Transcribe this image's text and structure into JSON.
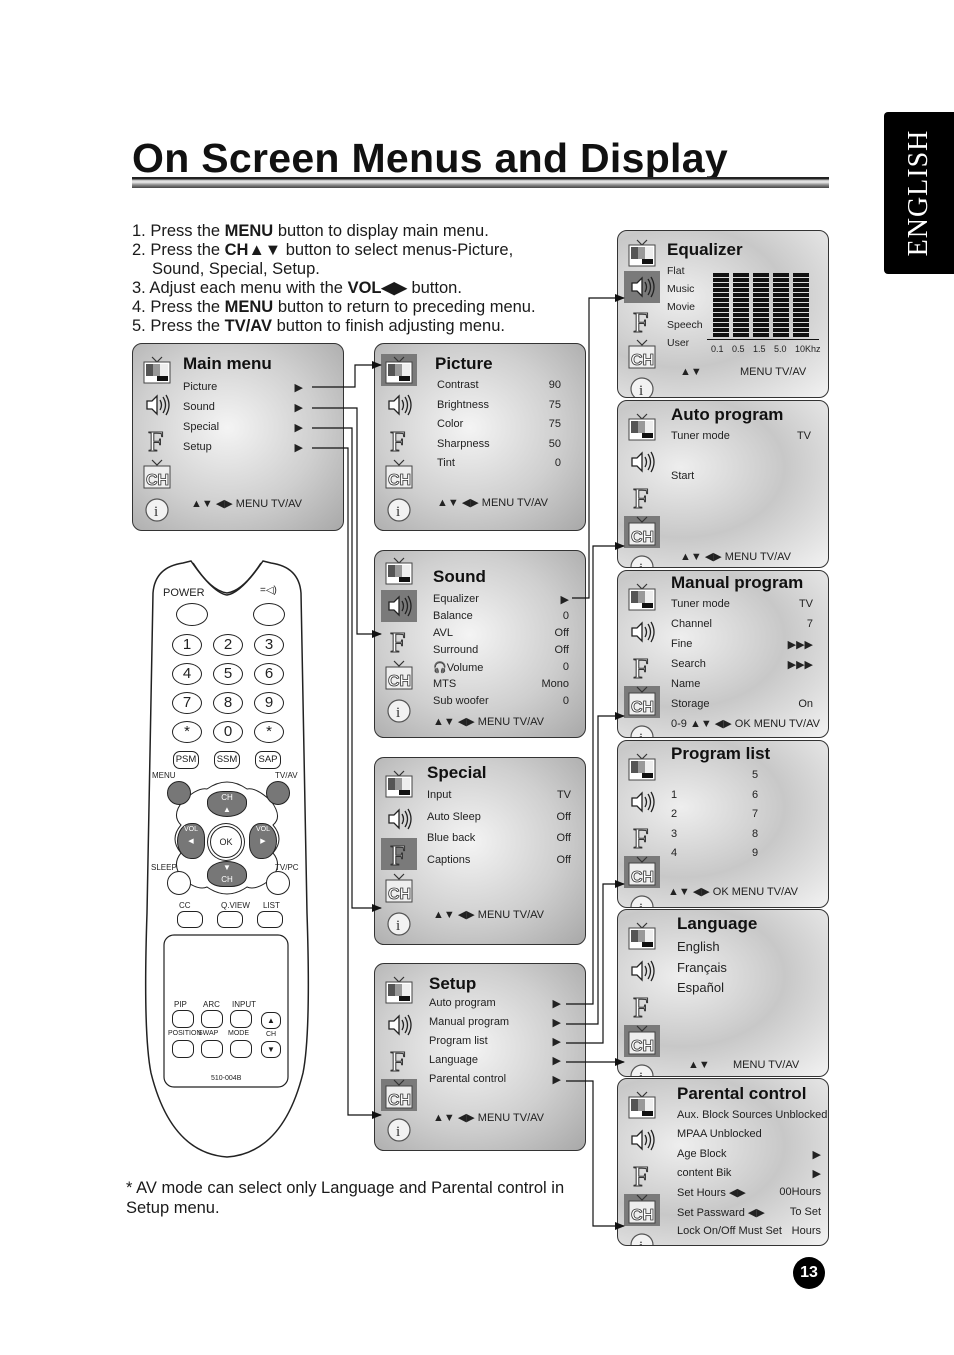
{
  "page": {
    "title": "On Screen Menus and Display",
    "language_tab": "ENGLISH",
    "page_number": "13",
    "footnote": "* AV mode can select only Language and Parental control in Setup menu."
  },
  "steps": [
    {
      "pre": "1. Press the ",
      "bold": "MENU",
      "post": " button to display main menu."
    },
    {
      "pre": "2. Press the ",
      "bold": "CH▲▼",
      "post": " button to select menus-Picture,"
    },
    {
      "pre": "",
      "bold": "",
      "post": "Sound, Special, Setup."
    },
    {
      "pre": "3. Adjust each menu with the ",
      "bold": "VOL◀▶",
      "post": " button."
    },
    {
      "pre": "4. Press the ",
      "bold": "MENU",
      "post": " button to return to preceding menu."
    },
    {
      "pre": "5. Press the ",
      "bold": "TV/AV",
      "post": " button to finish adjusting menu."
    }
  ],
  "icons": [
    "picture-icon",
    "sound-icon",
    "special-icon",
    "setup-ch-icon",
    "info-icon"
  ],
  "menus": {
    "main": {
      "title": "Main menu",
      "rows": [
        {
          "label": "Picture",
          "value": "▶"
        },
        {
          "label": "Sound",
          "value": "▶"
        },
        {
          "label": "Special",
          "value": "▶"
        },
        {
          "label": "Setup",
          "value": "▶"
        }
      ],
      "footer": "▲▼ ◀▶ MENU TV/AV"
    },
    "picture": {
      "title": "Picture",
      "rows": [
        {
          "label": "Contrast",
          "value": "90"
        },
        {
          "label": "Brightness",
          "value": "75"
        },
        {
          "label": "Color",
          "value": "75"
        },
        {
          "label": "Sharpness",
          "value": "50"
        },
        {
          "label": "Tint",
          "value": "0"
        }
      ],
      "footer": "▲▼ ◀▶    MENU    TV/AV"
    },
    "sound": {
      "title": "Sound",
      "rows": [
        {
          "label": "Equalizer",
          "value": "▶"
        },
        {
          "label": "Balance",
          "value": "0"
        },
        {
          "label": "AVL",
          "value": "Off"
        },
        {
          "label": "Surround",
          "value": "Off"
        },
        {
          "label": "🎧Volume",
          "value": "0"
        },
        {
          "label": "MTS",
          "value": "Mono"
        },
        {
          "label": "Sub woofer",
          "value": "0"
        }
      ],
      "footer": "▲▼ ◀▶   MENU  TV/AV"
    },
    "special": {
      "title": "Special",
      "rows": [
        {
          "label": "Input",
          "value": "TV"
        },
        {
          "label": "Auto Sleep",
          "value": "Off"
        },
        {
          "label": "Blue back",
          "value": "Off"
        },
        {
          "label": "Captions",
          "value": "Off"
        }
      ],
      "footer": "▲▼ ◀▶   MENU   TV/AV"
    },
    "setup": {
      "title": "Setup",
      "rows": [
        {
          "label": "Auto program",
          "value": "▶"
        },
        {
          "label": "Manual program",
          "value": "▶"
        },
        {
          "label": "Program list",
          "value": "▶"
        },
        {
          "label": "Language",
          "value": "▶"
        },
        {
          "label": "Parental control",
          "value": "▶"
        }
      ],
      "footer": "▲▼ ◀▶ MENU TV/AV"
    },
    "equalizer": {
      "title": "Equalizer",
      "modes": [
        "Flat",
        "Music",
        "Movie",
        "Speech",
        "User"
      ],
      "bands": [
        "0.1",
        "0.5",
        "1.5",
        "5.0",
        "10Khz"
      ],
      "levels": [
        0.5,
        0.5,
        0.5,
        0.5,
        0.5
      ],
      "footer_left": "▲▼",
      "footer_right": "MENU  TV/AV"
    },
    "auto_program": {
      "title": "Auto program",
      "rows": [
        {
          "label": "Tuner mode",
          "value": "TV"
        },
        {
          "label": "Start",
          "value": ""
        }
      ],
      "footer": "▲▼ ◀▶    MENU    TV/AV"
    },
    "manual_program": {
      "title": "Manual program",
      "rows": [
        {
          "label": "Tuner mode",
          "value": "TV"
        },
        {
          "label": "Channel",
          "value": "7"
        },
        {
          "label": "Fine",
          "value": "▶▶▶"
        },
        {
          "label": "Search",
          "value": "▶▶▶"
        },
        {
          "label": "Name",
          "value": ""
        },
        {
          "label": "Storage",
          "value": "On"
        }
      ],
      "footer": "0-9 ▲▼ ◀▶ OK MENU TV/AV"
    },
    "program_list": {
      "title": "Program list",
      "col1": [
        "",
        "1",
        "2",
        "3",
        "4"
      ],
      "col2": [
        "5",
        "6",
        "7",
        "8",
        "9"
      ],
      "footer": "▲▼ ◀▶ OK MENU TV/AV"
    },
    "language": {
      "title": "Language",
      "options": [
        "English",
        "Français",
        "Español"
      ],
      "footer_left": "▲▼",
      "footer_right": "MENU    TV/AV"
    },
    "parental": {
      "title": "Parental control",
      "rows": [
        {
          "label": "Aux. Block Sources Unblocked",
          "value": ""
        },
        {
          "label": "MPAA Unblocked",
          "value": ""
        },
        {
          "label": "Age Block",
          "value": "▶"
        },
        {
          "label": "content  Bik",
          "value": "▶"
        },
        {
          "label": "Set Hours      ◀▶",
          "value": "00Hours"
        },
        {
          "label": "Set Passward ◀▶",
          "value": "To  Set"
        },
        {
          "label": "Lock  On/Off  Must  Set",
          "value": "Hours"
        }
      ]
    }
  },
  "remote": {
    "power": "POWER",
    "mute": "mute",
    "digits": [
      "1",
      "2",
      "3",
      "4",
      "5",
      "6",
      "7",
      "8",
      "9",
      "*",
      "0",
      "*"
    ],
    "mode_buttons": [
      "PSM",
      "SSM",
      "SAP"
    ],
    "menu": "MENU",
    "tvav": "TV/AV",
    "ch": "CH",
    "vol": "VOL",
    "ok": "OK",
    "sleep": "SLEEP",
    "tvpc": "TV/PC",
    "row_labels": [
      "CC",
      "Q.VIEW",
      "LIST"
    ],
    "pip_labels": [
      "PIP",
      "ARC",
      "INPUT"
    ],
    "pos_labels": [
      "POSITION",
      "SWAP",
      "MODE"
    ],
    "ch_small": "CH",
    "model": "510-004B"
  }
}
